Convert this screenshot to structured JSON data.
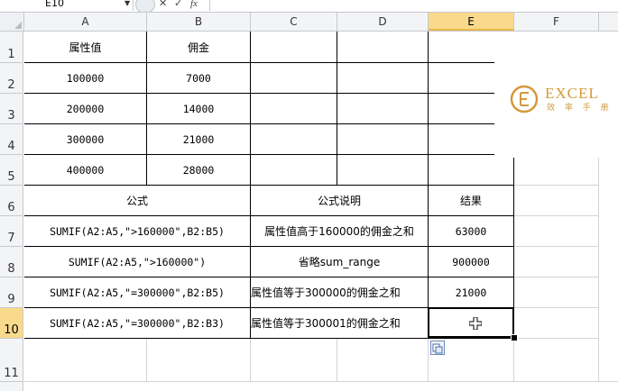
{
  "name_box": {
    "value": "E10"
  },
  "formula_bar": {
    "cancel_icon": "✕",
    "enter_icon": "✓",
    "function_icon": "fx",
    "value": ""
  },
  "columns": [
    "A",
    "B",
    "C",
    "D",
    "E",
    "F"
  ],
  "rows": [
    "1",
    "2",
    "3",
    "4",
    "5",
    "6",
    "7",
    "8",
    "9",
    "10",
    "11"
  ],
  "table1": {
    "headers": [
      "属性值",
      "佣金"
    ],
    "rows": [
      [
        "100000",
        "7000"
      ],
      [
        "200000",
        "14000"
      ],
      [
        "300000",
        "21000"
      ],
      [
        "400000",
        "28000"
      ]
    ]
  },
  "table2": {
    "headers": [
      "公式",
      "公式说明",
      "结果"
    ],
    "rows": [
      [
        "SUMIF(A2:A5,\">160000\",B2:B5)",
        "属性值高于160000的佣金之和",
        "63000"
      ],
      [
        "SUMIF(A2:A5,\">160000\")",
        "省略sum_range",
        "900000"
      ],
      [
        "SUMIF(A2:A5,\"=300000\",B2:B5)",
        "属性值等于300000的佣金之和",
        "21000"
      ],
      [
        "SUMIF(A2:A5,\"=300000\",B2:B3)",
        "属性值等于300001的佣金之和",
        ""
      ]
    ]
  },
  "logo": {
    "text": "EXCEL",
    "subtitle": "效 率 手 册",
    "color": "#d49a3a"
  },
  "colors": {
    "active_header": "#f9d98b",
    "grid": "#d4d4d4",
    "header_bg": "#f3f4f6"
  }
}
